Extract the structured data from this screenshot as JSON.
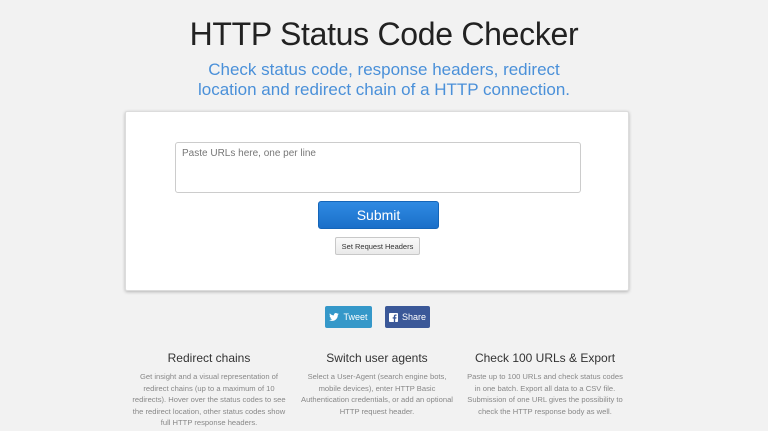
{
  "header": {
    "title": "HTTP Status Code Checker",
    "subtitle_line1": "Check status code, response headers, redirect",
    "subtitle_line2": "location and redirect chain of a HTTP connection."
  },
  "form": {
    "url_placeholder": "Paste URLs here, one per line",
    "url_value": "",
    "submit_label": "Submit",
    "headers_label": "Set Request Headers"
  },
  "share": {
    "tweet_label": "Tweet",
    "facebook_label": "Share",
    "tweet_color": "#3598c9",
    "facebook_color": "#3b5898"
  },
  "features": [
    {
      "title": "Redirect chains",
      "text": "Get insight and a visual representation of redirect chains (up to a maximum of 10 redirects). Hover over the status codes to see the redirect location, other status codes show full HTTP response headers."
    },
    {
      "title": "Switch user agents",
      "text": "Select a User-Agent (search engine bots, mobile devices), enter HTTP Basic Authentication credentials, or add an optional HTTP request header."
    },
    {
      "title": "Check 100 URLs & Export",
      "text": "Paste up to 100 URLs and check status codes in one batch. Export all data to a CSV file. Submission of one URL gives the possibility to check the HTTP response body as well."
    }
  ],
  "colors": {
    "accent": "#4a90d9",
    "submit": "#1a6fc9",
    "background": "#f2f2f2"
  }
}
